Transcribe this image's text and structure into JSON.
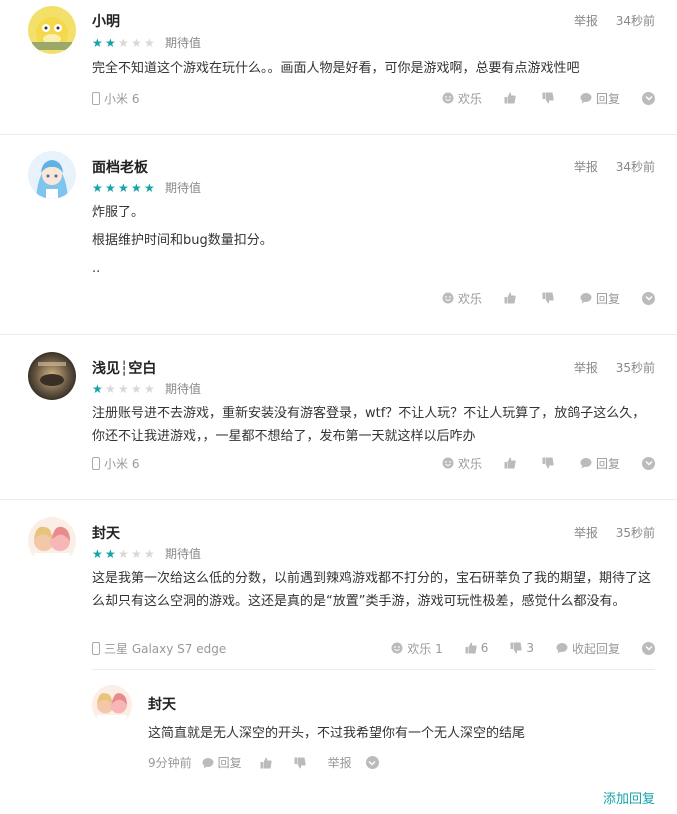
{
  "reviews": [
    {
      "name": "小明",
      "report": "举报",
      "time": "34秒前",
      "stars_filled": 2,
      "rating_label": "期待值",
      "paragraphs": [
        "完全不知道这个游戏在玩什么。。画面人物是好看，可你是游戏啊，总要有点游戏性吧"
      ],
      "device": "小米 6",
      "happy": "欢乐",
      "up_count": "",
      "down_count": "",
      "reply": "回复"
    },
    {
      "name": "面档老板",
      "report": "举报",
      "time": "34秒前",
      "stars_filled": 5,
      "rating_label": "期待值",
      "paragraphs": [
        "炸服了。",
        "根据维护时间和bug数量扣分。",
        ".."
      ],
      "device": "",
      "happy": "欢乐",
      "up_count": "",
      "down_count": "",
      "reply": "回复"
    },
    {
      "name": "浅见┆空白",
      "report": "举报",
      "time": "35秒前",
      "stars_filled": 1,
      "rating_label": "期待值",
      "paragraphs": [
        "注册账号进不去游戏，重新安装没有游客登录，wtf？不让人玩？不让人玩算了，放鸽子这么久，你还不让我进游戏，，一星都不想给了，发布第一天就这样以后咋办"
      ],
      "device": "小米 6",
      "happy": "欢乐",
      "up_count": "",
      "down_count": "",
      "reply": "回复"
    },
    {
      "name": "封天",
      "report": "举报",
      "time": "35秒前",
      "stars_filled": 2,
      "rating_label": "期待值",
      "paragraphs": [
        "这是我第一次给这么低的分数，以前遇到辣鸡游戏都不打分的，宝石研莘负了我的期望，期待了这么却只有这么空洞的游戏。这还是真的是“放置”类手游，游戏可玩性极差，感觉什么都没有。"
      ],
      "device": "三星 Galaxy S7 edge",
      "happy": "欢乐 1",
      "up_count": "6",
      "down_count": "3",
      "reply": "收起回复"
    }
  ],
  "sub_reply": {
    "name": "封天",
    "text": "这简直就是无人深空的开头，不过我希望你有一个无人深空的结尾",
    "time": "9分钟前",
    "reply": "回复",
    "report": "举报"
  },
  "add_reply": "添加回复",
  "colors": {
    "accent": "#14a3a8",
    "star_off": "#d8d8d8"
  }
}
